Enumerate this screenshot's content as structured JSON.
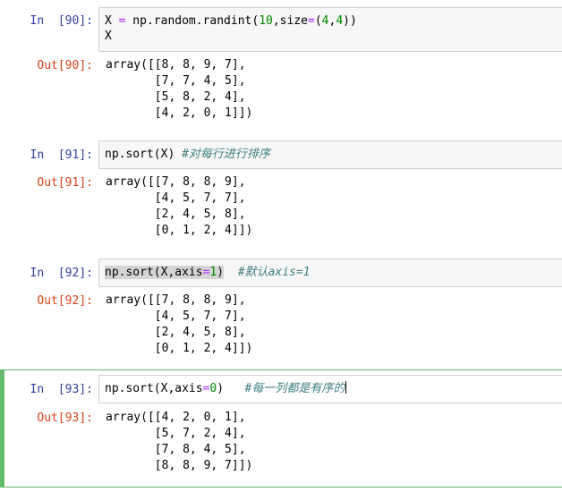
{
  "cells": [
    {
      "in_prompt": "In  [90]:",
      "out_prompt": "Out[90]:",
      "code_line1": {
        "a": "X ",
        "eq": "=",
        "b": " np.random.randint(",
        "n1": "10",
        "c": ",size",
        "eq2": "=",
        "d": "(",
        "n2": "4",
        "e": ",",
        "n3": "4",
        "f": "))"
      },
      "code_line2": "X",
      "output": "array([[8, 8, 9, 7],\n       [7, 7, 4, 5],\n       [5, 8, 2, 4],\n       [4, 2, 0, 1]])"
    },
    {
      "in_prompt": "In  [91]:",
      "out_prompt": "Out[91]:",
      "code": "np.sort(X)",
      "comment": "#对每行进行排序",
      "output": "array([[7, 8, 8, 9],\n       [4, 5, 7, 7],\n       [2, 4, 5, 8],\n       [0, 1, 2, 4]])"
    },
    {
      "in_prompt": "In  [92]:",
      "out_prompt": "Out[92]:",
      "code_a": "np.sort(X,axis",
      "code_eq": "=",
      "code_num": "1",
      "code_b": ")",
      "comment": "#默认axis=1",
      "output": "array([[7, 8, 8, 9],\n       [4, 5, 7, 7],\n       [2, 4, 5, 8],\n       [0, 1, 2, 4]])"
    },
    {
      "in_prompt": "In  [93]:",
      "out_prompt": "Out[93]:",
      "code_a": "np.sort(X,axis",
      "code_eq": "=",
      "code_num": "0",
      "code_b": ")",
      "comment": "#每一列都是有序的",
      "output": "array([[4, 2, 0, 1],\n       [5, 7, 2, 4],\n       [7, 8, 4, 5],\n       [8, 8, 9, 7]])"
    }
  ]
}
